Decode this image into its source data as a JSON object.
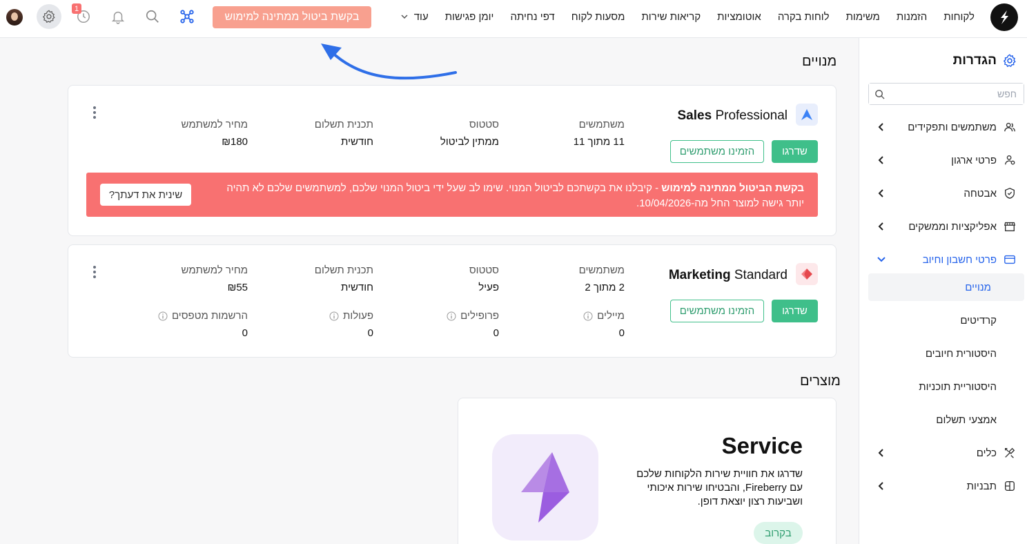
{
  "topbar": {
    "nav_items": [
      "לקוחות",
      "הזמנות",
      "משימות",
      "לוחות בקרה",
      "אוטומציות",
      "קריאות שירות",
      "מסעות לקוח",
      "דפי נחיתה",
      "יומן פגישות"
    ],
    "more_label": "עוד",
    "cancel_pill_label": "בקשת ביטול ממתינה למימוש",
    "notification_badge": "1"
  },
  "sidebar": {
    "title": "הגדרות",
    "search_placeholder": "חפש",
    "items": [
      {
        "label": "משתמשים ותפקידים",
        "icon": "users-icon"
      },
      {
        "label": "פרטי ארגון",
        "icon": "org-icon"
      },
      {
        "label": "אבטחה",
        "icon": "shield-icon"
      },
      {
        "label": "אפליקציות וממשקים",
        "icon": "store-icon"
      },
      {
        "label": "פרטי חשבון וחיוב",
        "icon": "credit-card-icon"
      }
    ],
    "sub_items": [
      "מנויים",
      "קרדיטים",
      "היסטורית חיובים",
      "היסטוריית תוכניות",
      "אמצעי תשלום"
    ],
    "bottom_items": [
      {
        "label": "כלים",
        "icon": "tools-icon"
      },
      {
        "label": "תבניות",
        "icon": "templates-icon"
      }
    ]
  },
  "subscriptions": {
    "title": "מנויים",
    "plans": [
      {
        "name_bold": "Sales",
        "name_rest": "Professional",
        "users_label": "משתמשים",
        "users_value": "11 מתוך 11",
        "status_label": "סטטוס",
        "status_value": "ממתין לביטול",
        "billing_label": "תכנית תשלום",
        "billing_value": "חודשית",
        "price_label": "מחיר למשתמש",
        "price_value": "₪180",
        "upgrade_label": "שדרגו",
        "invite_label": "הזמינו משתמשים",
        "alert_bold": "בקשת הביטול ממתינה למימוש",
        "alert_text": " - קיבלנו את בקשתכם לביטול המנוי. שימו לב שעל ידי ביטול המנוי שלכם, למשתמשים שלכם לא תהיה יותר גישה למוצר החל מה-10/04/2026.",
        "alert_button": "שינית את דעתך?"
      },
      {
        "name_bold": "Marketing",
        "name_rest": "Standard",
        "users_label": "משתמשים",
        "users_value": "2 מתוך 2",
        "status_label": "סטטוס",
        "status_value": "פעיל",
        "billing_label": "תכנית תשלום",
        "billing_value": "חודשית",
        "price_label": "מחיר למשתמש",
        "price_value": "₪55",
        "upgrade_label": "שדרגו",
        "invite_label": "הזמינו משתמשים",
        "usage": [
          {
            "label": "מיילים",
            "value": "0"
          },
          {
            "label": "פרופילים",
            "value": "0"
          },
          {
            "label": "פעולות",
            "value": "0"
          },
          {
            "label": "הרשמות מטפסים",
            "value": "0"
          }
        ]
      }
    ]
  },
  "products": {
    "title": "מוצרים",
    "items": [
      {
        "name": "Service",
        "description": "שדרגו את חוויית שירות הלקוחות שלכם עם Fireberry, והבטיחו שירות איכותי ושביעות רצון יוצאת דופן.",
        "badge": "בקרוב"
      }
    ]
  },
  "colors": {
    "accent": "#2563eb",
    "green": "#3fbf8a",
    "alert": "#f87171",
    "pill": "#f8a08f"
  }
}
